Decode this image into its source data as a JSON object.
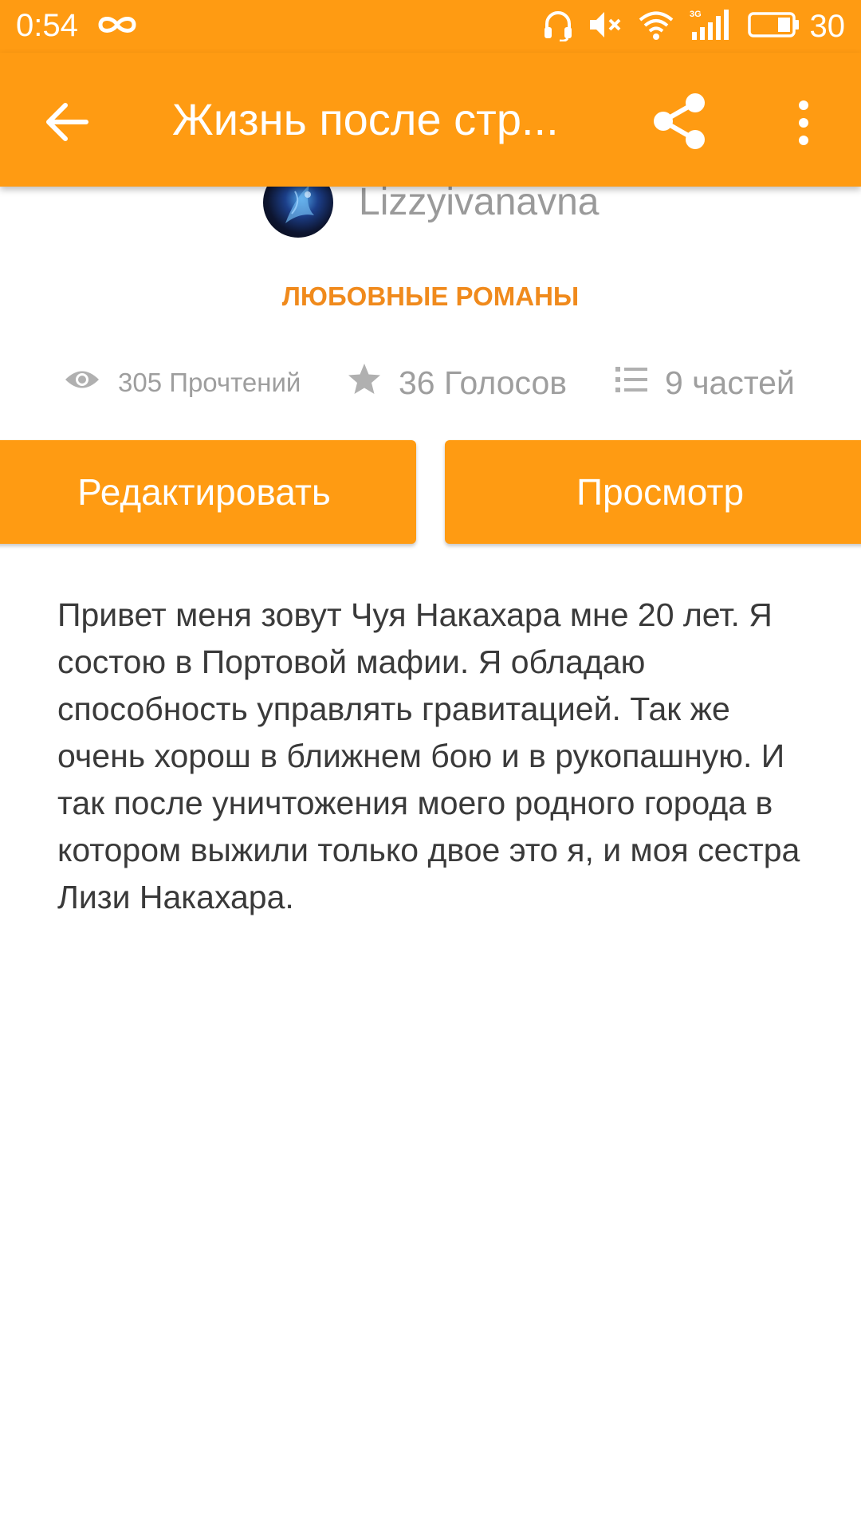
{
  "status_bar": {
    "time": "0:54",
    "network": "3G",
    "battery": "30"
  },
  "toolbar": {
    "title": "Жизнь после стр...",
    "background": "#ff9b12"
  },
  "author": {
    "name": "Lizzyivanavna"
  },
  "story": {
    "category": "ЛЮБОВНЫЕ РОМАНЫ",
    "stats": {
      "reads": "305 Прочтений",
      "votes": "36 Голосов",
      "parts": "9 частей"
    },
    "description": "Привет меня зовут Чуя Накахара мне 20 лет. Я состою в Портовой мафии. Я обладаю способность управлять гравитацией. Так же очень хорош в ближнем бою и в рукопашную. И так после уничтожения моего родного города в котором выжили только двое это я, и моя сестра Лизи Накахара."
  },
  "actions": {
    "edit_label": "Редактировать",
    "view_label": "Просмотр"
  },
  "colors": {
    "accent": "#ff9b12",
    "category": "#f08a1c",
    "muted": "#9e9e9e"
  },
  "icons": [
    "infinity-icon",
    "headphones-icon",
    "mute-icon",
    "wifi-icon",
    "signal-icon",
    "battery-icon",
    "back-arrow-icon",
    "share-icon",
    "more-vertical-icon",
    "eye-icon",
    "star-icon",
    "list-icon"
  ]
}
